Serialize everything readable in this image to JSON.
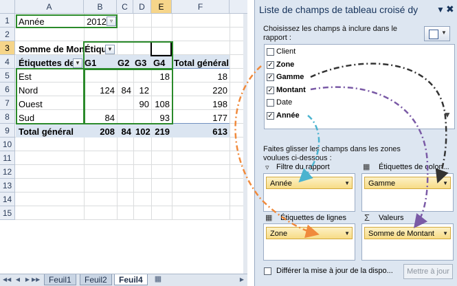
{
  "sheet": {
    "columns": [
      "A",
      "B",
      "C",
      "D",
      "E",
      "F"
    ],
    "rows": [
      "1",
      "2",
      "3",
      "4",
      "5",
      "6",
      "7",
      "8",
      "9",
      "10",
      "11",
      "12",
      "13",
      "14",
      "15"
    ],
    "filter": {
      "label": "Année",
      "value": "2012"
    },
    "pivot": {
      "corner": "Somme de Montant",
      "col_label_header": "Étiquettes de colonnes",
      "row_label_header": "Étiquettes de lignes",
      "col_headers": [
        "G1",
        "G2",
        "G3",
        "G4",
        "Total général"
      ],
      "rows": [
        {
          "label": "Est",
          "g1": "",
          "g2": "",
          "g3": "",
          "g4": "18",
          "total": "18"
        },
        {
          "label": "Nord",
          "g1": "124",
          "g2": "84",
          "g3": "12",
          "g4": "",
          "total": "220"
        },
        {
          "label": "Ouest",
          "g1": "",
          "g2": "",
          "g3": "90",
          "g4": "108",
          "total": "198"
        },
        {
          "label": "Sud",
          "g1": "84",
          "g2": "",
          "g3": "",
          "g4": "93",
          "total": "177"
        }
      ],
      "grand_total": {
        "label": "Total général",
        "g1": "208",
        "g2": "84",
        "g3": "102",
        "g4": "219",
        "total": "613"
      }
    },
    "tabs": [
      "Feuil1",
      "Feuil2",
      "Feuil4"
    ],
    "active_tab": "Feuil4"
  },
  "pane": {
    "title": "Liste de champs de tableau croisé dy",
    "instruction": "Choisissez les champs à inclure dans le rapport :",
    "fields": [
      {
        "label": "Client",
        "checked": false,
        "bold": false
      },
      {
        "label": "Zone",
        "checked": true,
        "bold": true
      },
      {
        "label": "Gamme",
        "checked": true,
        "bold": true
      },
      {
        "label": "Montant",
        "checked": true,
        "bold": true
      },
      {
        "label": "Date",
        "checked": false,
        "bold": false
      },
      {
        "label": "Année",
        "checked": true,
        "bold": true
      }
    ],
    "drag_instruction": "Faites glisser les champs dans les zones voulues ci-dessous :",
    "zones": {
      "filter": {
        "label": "Filtre du rapport",
        "item": "Année"
      },
      "columns": {
        "label": "Étiquettes de colon...",
        "item": "Gamme"
      },
      "rows": {
        "label": "Étiquettes de lignes",
        "item": "Zone"
      },
      "values": {
        "label": "Valeurs",
        "item": "Somme de Montant"
      }
    },
    "defer_label": "Différer la mise à jour de la dispo...",
    "update_button": "Mettre à jour"
  },
  "colors": {
    "arrow_dark": "#333333",
    "arrow_orange": "#f08a3c",
    "arrow_purple": "#7a5aa6",
    "arrow_cyan": "#4ab3cf",
    "pivot_band": "#dbe5f1",
    "highlight_box": "#2a8a2a"
  }
}
